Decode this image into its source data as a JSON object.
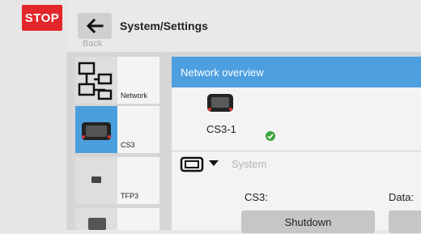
{
  "stop_label": "STOP",
  "header": {
    "back_label": "Back",
    "title": "System/Settings"
  },
  "sidebar": {
    "tiles": [
      {
        "label": "Network",
        "icon": "network-icon",
        "selected": false
      },
      {
        "label": "CS3",
        "icon": "cs3-device-icon",
        "selected": true
      },
      {
        "label": "TFP3",
        "icon": "tfp3-device-icon",
        "selected": false
      },
      {
        "label": "",
        "icon": "device-icon",
        "selected": false
      }
    ]
  },
  "main": {
    "network_title": "Network overview",
    "device_name": "CS3-1",
    "section_label": "System",
    "cs3_label": "CS3:",
    "data_label": "Data:",
    "shutdown_label": "Shutdown"
  },
  "colors": {
    "stop_red": "#e2262b",
    "accent_blue": "#4d9fe0",
    "ok_green": "#3ba53b"
  }
}
